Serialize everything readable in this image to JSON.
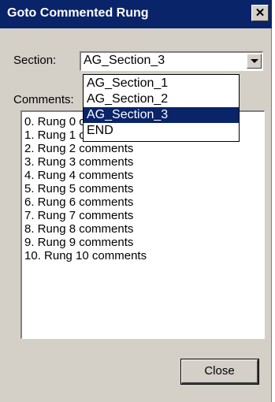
{
  "dialog": {
    "title": "Goto Commented Rung",
    "close_glyph": "✕"
  },
  "section": {
    "label": "Section:",
    "value": "AG_Section_3",
    "options": [
      "AG_Section_1",
      "AG_Section_2",
      "AG_Section_3",
      "END"
    ],
    "selected_index": 2
  },
  "comments": {
    "label": "Comments:",
    "items": [
      "0. Rung 0 comments",
      "1. Rung 1 comments",
      "2. Rung 2 comments",
      "3. Rung 3 comments",
      "4. Rung 4 comments",
      "5. Rung 5 comments",
      "6. Rung 6 comments",
      "7. Rung 7 comments",
      "8. Rung 8 comments",
      "9. Rung 9 comments",
      "10. Rung 10 comments"
    ]
  },
  "buttons": {
    "close_label": "Close"
  },
  "colors": {
    "titlebar": "#0a246a",
    "face": "#d4d0c8",
    "highlight": "#0a246a"
  }
}
